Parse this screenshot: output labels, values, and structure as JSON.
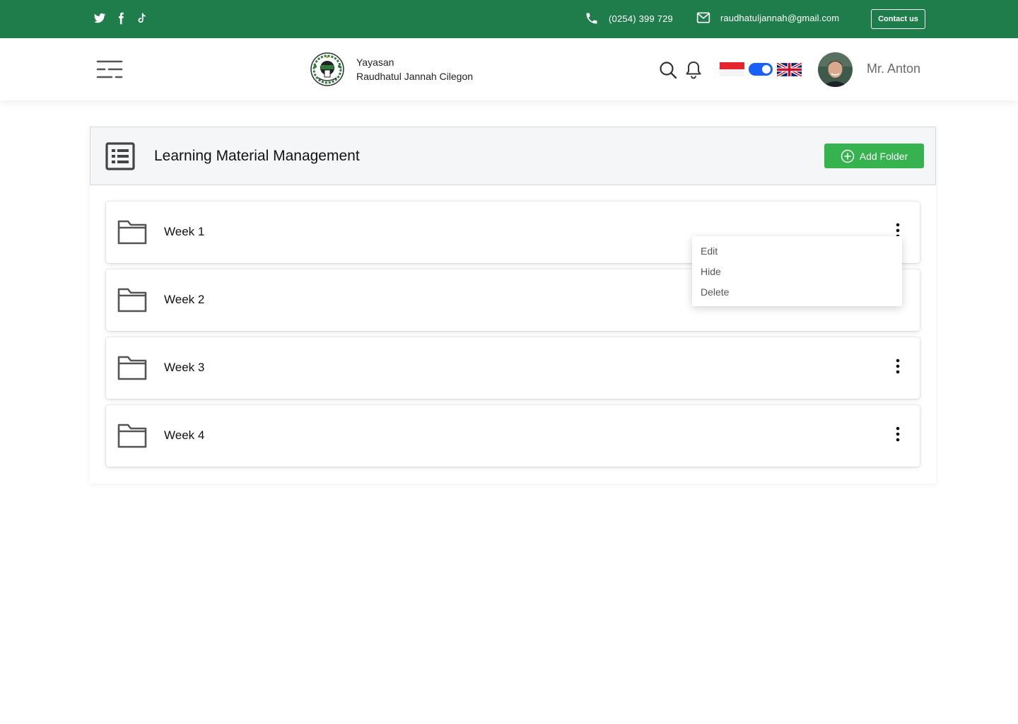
{
  "topbar": {
    "social_icons": [
      "twitter-icon",
      "facebook-icon",
      "tiktok-icon"
    ],
    "phone": "(0254) 399 729",
    "email": "raudhatuljannah@gmail.com",
    "contact_label": "Contact us",
    "background_color": "#1e7d4a"
  },
  "header": {
    "brand_line1": "Yayasan",
    "brand_line2": "Raudhatul Jannah Cilegon",
    "language_toggle": "on",
    "user_name": "Mr. Anton"
  },
  "panel": {
    "title": "Learning Material Management",
    "add_label": "Add Folder",
    "accent_color": "#36b24f",
    "folders": [
      {
        "name": "Week 1"
      },
      {
        "name": "Week 2"
      },
      {
        "name": "Week 3"
      },
      {
        "name": "Week 4"
      }
    ]
  },
  "dropdown": {
    "options": [
      "Edit",
      "Hide",
      "Delete"
    ]
  }
}
